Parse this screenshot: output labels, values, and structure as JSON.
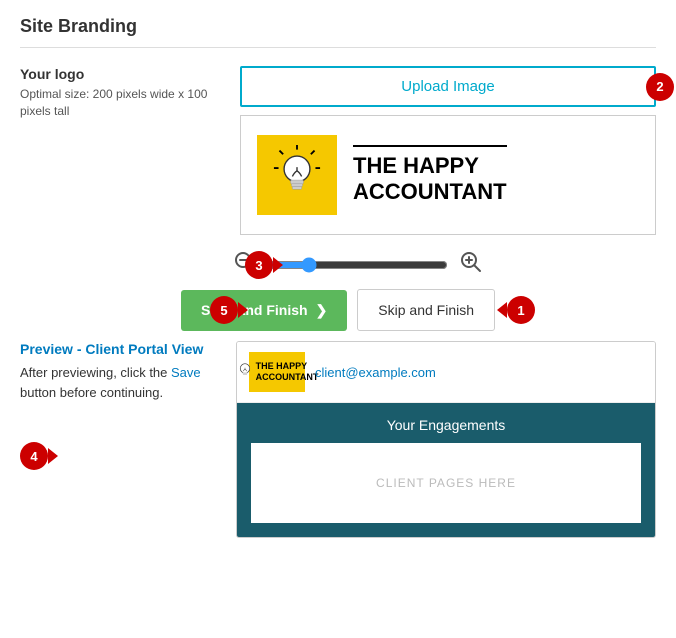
{
  "page": {
    "title": "Site Branding"
  },
  "logo": {
    "label": "Your logo",
    "hint": "Optimal size: 200 pixels wide x 100 pixels tall",
    "upload_button": "Upload Image",
    "preview_text_line1": "THE HAPPY",
    "preview_text_line2": "ACCOUNTANT"
  },
  "zoom": {
    "badge": "3",
    "min_icon": "🔍",
    "max_icon": "🔍"
  },
  "buttons": {
    "save_finish": "Save and Finish",
    "skip_finish": "Skip and Finish"
  },
  "badges": {
    "b1": "1",
    "b2": "2",
    "b3": "3",
    "b4": "4",
    "b5": "5"
  },
  "preview": {
    "title": "Preview - Client Portal View",
    "hint_part1": "After previewing, click the Save button before continuing.",
    "hint_save": "Save",
    "email": "client@example.com",
    "engagements_title": "Your Engagements",
    "placeholder": "CLIENT PAGES HERE"
  }
}
